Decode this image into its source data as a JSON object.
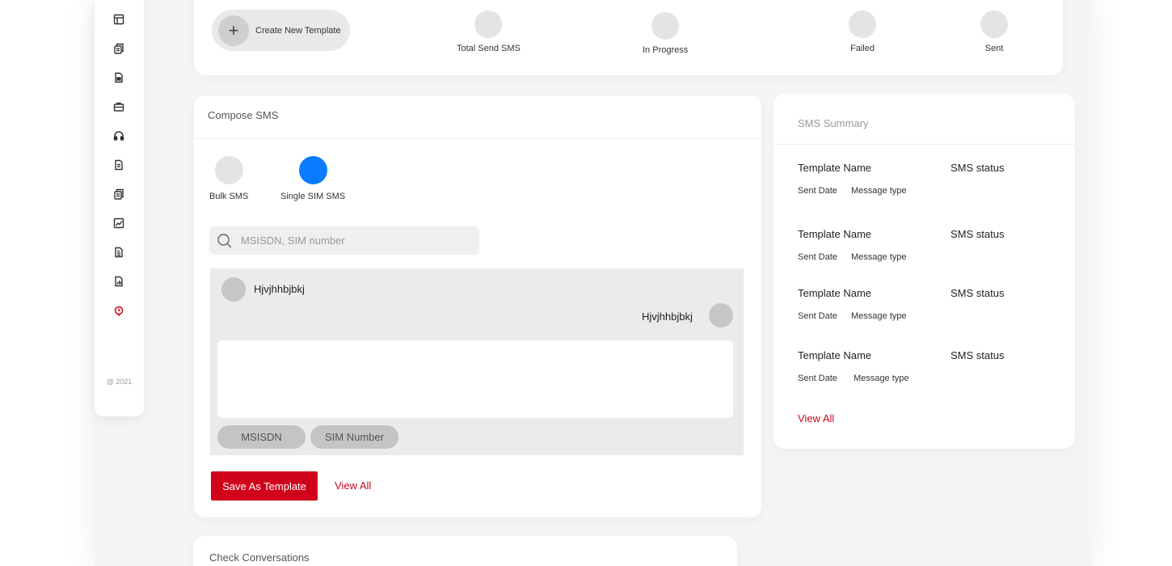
{
  "sidebar": {
    "icons": [
      "layout-icon",
      "copy-icon",
      "file-icon",
      "briefcase-icon",
      "headset-icon",
      "document-icon",
      "copy-icon",
      "chart-icon",
      "text-file-icon",
      "report-icon",
      "location-pin-icon"
    ],
    "active_color": "#d0021b",
    "copyright": "@ 2021"
  },
  "stats": {
    "create_label": "Create New Template",
    "items": [
      {
        "label": "Total Send SMS"
      },
      {
        "label": "In Progress"
      },
      {
        "label": "Failed"
      },
      {
        "label": "Sent"
      }
    ]
  },
  "compose": {
    "title": "Compose SMS",
    "modes": [
      {
        "label": "Bulk SMS",
        "active": false
      },
      {
        "label": "Single SIM SMS",
        "active": true
      }
    ],
    "search_placeholder": "MSISDN, SIM number",
    "messages": [
      {
        "text": "Hjvjhhbjbkj",
        "side": "left"
      },
      {
        "text": "Hjvjhhbjbkj",
        "side": "right"
      }
    ],
    "pills": [
      "MSISDN",
      "SIM Number"
    ],
    "save_label": "Save As Template",
    "view_all": "View All",
    "accent": "#d0021b",
    "active_mode_color": "#0a7bff"
  },
  "summary": {
    "title": "SMS Summary",
    "rows": [
      {
        "template_name": "Template Name",
        "sms_status": "SMS status",
        "sent_date": "Sent Date",
        "message_type": "Message type"
      },
      {
        "template_name": "Template Name",
        "sms_status": "SMS status",
        "sent_date": "Sent Date",
        "message_type": "Message type"
      },
      {
        "template_name": "Template Name",
        "sms_status": "SMS status",
        "sent_date": "Sent Date",
        "message_type": "Message type"
      },
      {
        "template_name": "Template Name",
        "sms_status": "SMS status",
        "sent_date": "Sent Date",
        "message_type": "Message type"
      }
    ],
    "view_all": "View All"
  },
  "conversations": {
    "title": "Check Conversations"
  }
}
